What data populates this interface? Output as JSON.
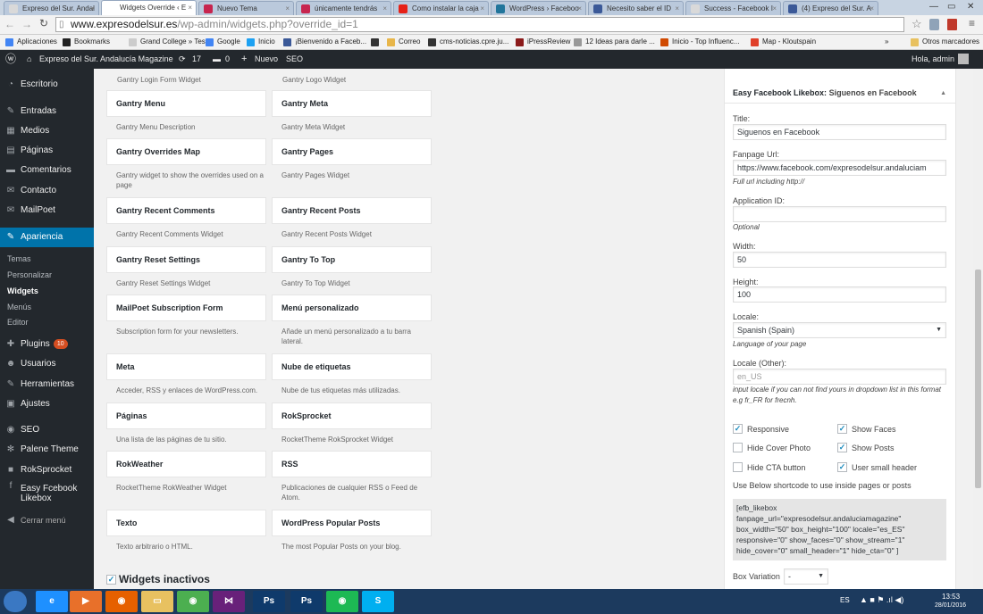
{
  "browser": {
    "tabs": [
      {
        "title": "Expreso del Sur. Andal",
        "color": "#d9d9d9",
        "active": false
      },
      {
        "title": "Widgets Override ‹ E",
        "color": "#ffffff",
        "active": true
      },
      {
        "title": "Nuevo Tema",
        "color": "#c7254e",
        "active": false
      },
      {
        "title": "únicamente tendrás",
        "color": "#c7254e",
        "active": false
      },
      {
        "title": "Como instalar la caja",
        "color": "#e62117",
        "active": false
      },
      {
        "title": "WordPress › Faceboo",
        "color": "#21759b",
        "active": false
      },
      {
        "title": "Necesito saber el ID",
        "color": "#3b5998",
        "active": false
      },
      {
        "title": "Success - Facebook I",
        "color": "#d9d9d9",
        "active": false
      },
      {
        "title": "(4) Expreso del Sur. A",
        "color": "#3b5998",
        "active": false
      }
    ],
    "url_domain": "www.expresodelsur.es",
    "url_path": "/wp-admin/widgets.php?override_id=1",
    "bookmarks": [
      {
        "label": "Aplicaciones",
        "color": "#4285f4"
      },
      {
        "label": "Bookmarks",
        "color": "#222222"
      },
      {
        "label": "Grand College » Tes...",
        "color": "#cccccc"
      },
      {
        "label": "Google",
        "color": "#4285f4"
      },
      {
        "label": "Inicio",
        "color": "#1da1f2"
      },
      {
        "label": "¡Bienvenido a Faceb...",
        "color": "#3b5998"
      },
      {
        "label": "",
        "color": "#333333"
      },
      {
        "label": "Correo",
        "color": "#e8b64a"
      },
      {
        "label": "cms-noticias.cpre.ju...",
        "color": "#333333"
      },
      {
        "label": "iPressReview",
        "color": "#8b1a1a"
      },
      {
        "label": "12 Ideas para darle ...",
        "color": "#999999"
      },
      {
        "label": "Inicio - Top Influenc...",
        "color": "#d04a02"
      },
      {
        "label": "Map - Kloutspain",
        "color": "#e0402a"
      }
    ],
    "bookmarks_more": "»",
    "other_bookmarks": "Otros marcadores"
  },
  "adminbar": {
    "site_name": "Expreso del Sur. Andalucía Magazine",
    "updates": "17",
    "comments": "0",
    "new": "Nuevo",
    "seo": "SEO",
    "greeting": "Hola, admin"
  },
  "sidebar": {
    "items": [
      {
        "label": "Escritorio",
        "icon": "dashboard-icon",
        "glyph": "◔"
      },
      {
        "label": "Entradas",
        "icon": "pin-icon",
        "glyph": "✎"
      },
      {
        "label": "Medios",
        "icon": "media-icon",
        "glyph": "▦"
      },
      {
        "label": "Páginas",
        "icon": "pages-icon",
        "glyph": "▤"
      },
      {
        "label": "Comentarios",
        "icon": "comment-icon",
        "glyph": "▬"
      },
      {
        "label": "Contacto",
        "icon": "mail-icon",
        "glyph": "✉"
      },
      {
        "label": "MailPoet",
        "icon": "mail-icon",
        "glyph": "✉"
      }
    ],
    "active": {
      "label": "Apariencia",
      "icon": "brush-icon",
      "glyph": "✎"
    },
    "submenu": [
      "Temas",
      "Personalizar",
      "Widgets",
      "Menús",
      "Editor"
    ],
    "items2": [
      {
        "label": "Plugins",
        "icon": "plugin-icon",
        "glyph": "✚",
        "badge": "10"
      },
      {
        "label": "Usuarios",
        "icon": "users-icon",
        "glyph": "☻"
      },
      {
        "label": "Herramientas",
        "icon": "wrench-icon",
        "glyph": "✎"
      },
      {
        "label": "Ajustes",
        "icon": "settings-icon",
        "glyph": "▣"
      },
      {
        "label": "SEO",
        "icon": "seo-icon",
        "glyph": "◉"
      },
      {
        "label": "Palene Theme",
        "icon": "gear-icon",
        "glyph": "✻"
      },
      {
        "label": "RokSprocket",
        "icon": "roksprocket-icon",
        "glyph": "■"
      },
      {
        "label": "Easy Fcebook Likebox",
        "icon": "facebook-icon",
        "glyph": "f"
      }
    ],
    "collapse": "Cerrar menú"
  },
  "widgets": {
    "top_descs": [
      "Gantry Login Form Widget",
      "Gantry Logo Widget"
    ],
    "rows": [
      [
        {
          "title": "Gantry Menu",
          "desc": "Gantry Menu Description"
        },
        {
          "title": "Gantry Meta",
          "desc": "Gantry Meta Widget"
        }
      ],
      [
        {
          "title": "Gantry Overrides Map",
          "desc": "Gantry widget to show the overrides used on a page"
        },
        {
          "title": "Gantry Pages",
          "desc": "Gantry Pages Widget"
        }
      ],
      [
        {
          "title": "Gantry Recent Comments",
          "desc": "Gantry Recent Comments Widget"
        },
        {
          "title": "Gantry Recent Posts",
          "desc": "Gantry Recent Posts Widget"
        }
      ],
      [
        {
          "title": "Gantry Reset Settings",
          "desc": "Gantry Reset Settings Widget"
        },
        {
          "title": "Gantry To Top",
          "desc": "Gantry To Top Widget"
        }
      ],
      [
        {
          "title": "MailPoet Subscription Form",
          "desc": "Subscription form for your newsletters."
        },
        {
          "title": "Menú personalizado",
          "desc": "Añade un menú personalizado a tu barra lateral."
        }
      ],
      [
        {
          "title": "Meta",
          "desc": "Acceder, RSS y enlaces de WordPress.com."
        },
        {
          "title": "Nube de etiquetas",
          "desc": "Nube de tus etiquetas más utilizadas."
        }
      ],
      [
        {
          "title": "Páginas",
          "desc": "Una lista de las páginas de tu sitio."
        },
        {
          "title": "RokSprocket",
          "desc": "RocketTheme RokSprocket Widget"
        }
      ],
      [
        {
          "title": "RokWeather",
          "desc": "RocketTheme RokWeather Widget"
        },
        {
          "title": "RSS",
          "desc": "Publicaciones de cualquier RSS o Feed de Atom."
        }
      ],
      [
        {
          "title": "Texto",
          "desc": "Texto arbitrario o HTML."
        },
        {
          "title": "WordPress Popular Posts",
          "desc": "The most Popular Posts on your blog."
        }
      ]
    ],
    "inactive_title": "Widgets inactivos"
  },
  "likebox": {
    "header_name": "Easy Facebook Likebox:",
    "header_title": "Siguenos en Facebook",
    "title_label": "Title:",
    "title_value": "Siguenos en Facebook",
    "fanpage_label": "Fanpage Url:",
    "fanpage_value": "https://www.facebook.com/expresodelsur.andaluciam",
    "fanpage_hint": "Full url including http://",
    "appid_label": "Application ID:",
    "appid_value": "",
    "appid_hint": "Optional",
    "width_label": "Width:",
    "width_value": "50",
    "height_label": "Height:",
    "height_value": "100",
    "locale_label": "Locale:",
    "locale_value": "Spanish (Spain)",
    "locale_hint": "Language of your page",
    "locale_other_label": "Locale (Other):",
    "locale_other_placeholder": "en_US",
    "locale_other_hint": "input locale if you can not find yours in dropdown list in this format e.g fr_FR for frecnh.",
    "checkboxes": [
      {
        "label": "Responsive",
        "checked": true
      },
      {
        "label": "Show Faces",
        "checked": true
      },
      {
        "label": "Hide Cover Photo",
        "checked": false
      },
      {
        "label": "Show Posts",
        "checked": true
      },
      {
        "label": "Hide CTA button",
        "checked": false
      },
      {
        "label": "User small header",
        "checked": true
      }
    ],
    "shortcode_label": "Use Below shortcode to use inside pages or posts",
    "shortcode": "[efb_likebox\nfanpage_url=\"expresodelsur.andaluciamagazine\"\nbox_width=\"50\" box_height=\"100\" locale=\"es_ES\"\nresponsive=\"0\" show_faces=\"0\" show_stream=\"1\"\nhide_cover=\"0\" small_header=\"1\" hide_cta=\"0\" ]",
    "variation_label": "Box Variation",
    "variation_value": "-"
  },
  "taskbar": {
    "apps": [
      {
        "icon": "ie-icon",
        "glyph": "e",
        "color": "#1e90ff"
      },
      {
        "icon": "media-player-icon",
        "glyph": "▶",
        "color": "#e8702a"
      },
      {
        "icon": "firefox-icon",
        "glyph": "◉",
        "color": "#e66000"
      },
      {
        "icon": "folder-icon",
        "glyph": "▭",
        "color": "#e8c160"
      },
      {
        "icon": "chrome-icon",
        "glyph": "◉",
        "color": "#4caf50"
      },
      {
        "icon": "vs-icon",
        "glyph": "⋈",
        "color": "#68217a"
      },
      {
        "icon": "photoshop-icon",
        "glyph": "Ps",
        "color": "#0f3a6b"
      },
      {
        "icon": "photoshop-icon",
        "glyph": "Ps",
        "color": "#0f3a6b"
      },
      {
        "icon": "spotify-icon",
        "glyph": "◉",
        "color": "#1db954"
      },
      {
        "icon": "skype-icon",
        "glyph": "S",
        "color": "#00aff0"
      }
    ],
    "lang": "ES",
    "time": "13:53",
    "date": "28/01/2016"
  }
}
